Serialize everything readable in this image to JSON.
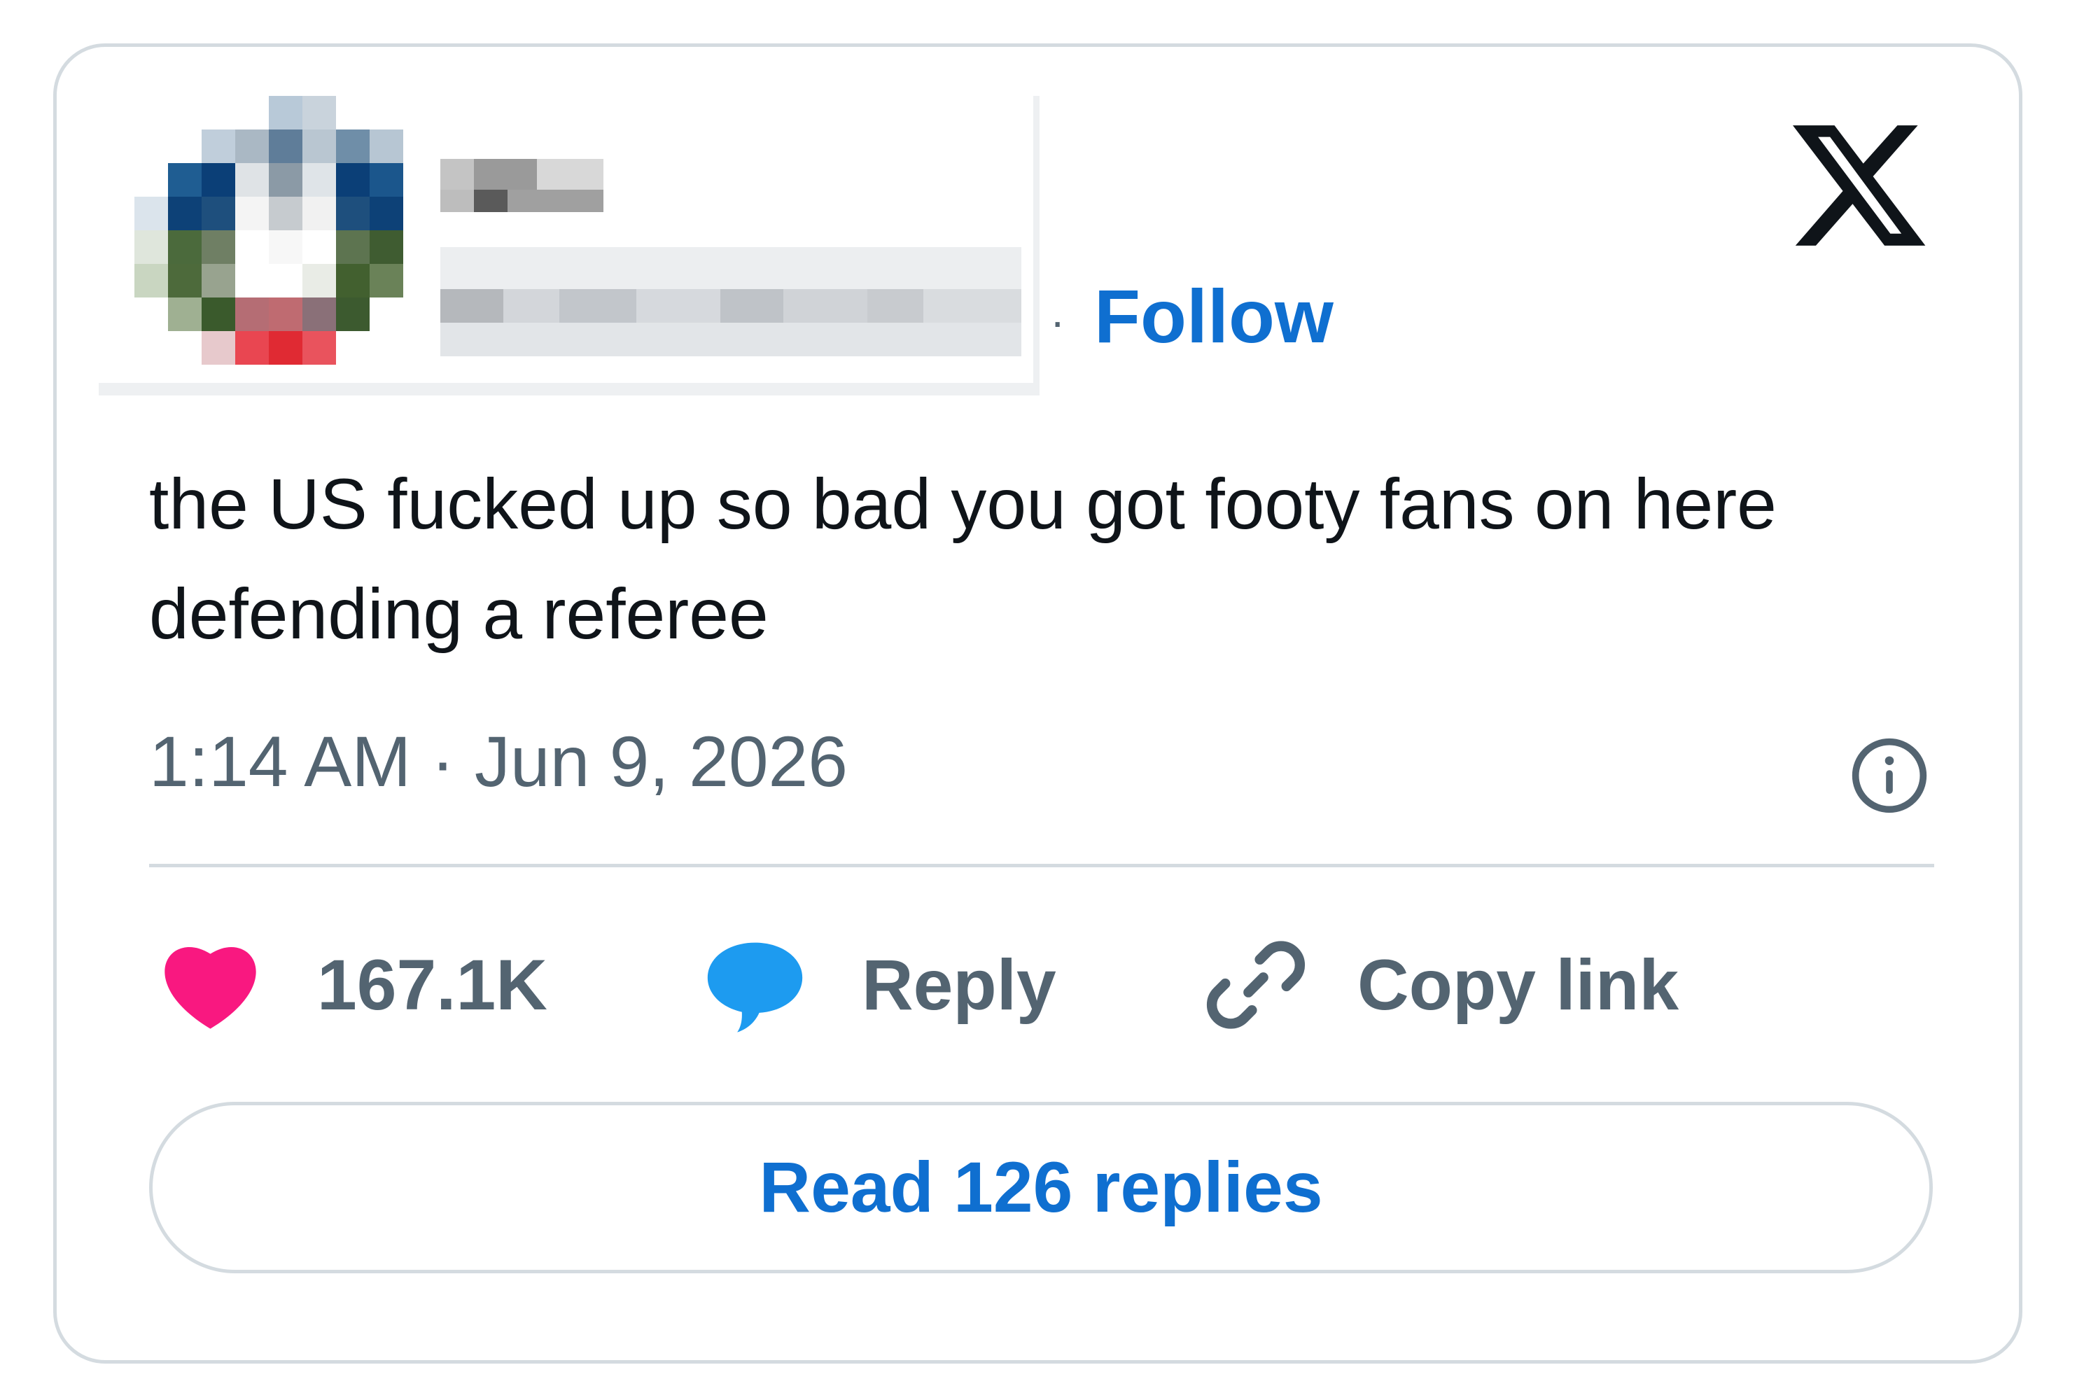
{
  "header": {
    "follow_label": "Follow",
    "separator": "·"
  },
  "tweet": {
    "text": "the US fucked up so bad you got footy fans on here defending a referee",
    "time": "1:14 AM",
    "separator": "·",
    "date": "Jun 9, 2026"
  },
  "actions": {
    "like_count": "167.1K",
    "reply_label": "Reply",
    "copy_label": "Copy link"
  },
  "read_replies_label": "Read 126 replies",
  "colors": {
    "accent": "#0f6fd0",
    "like": "#f91880",
    "reply": "#1d9bf0",
    "text": "#0f1419",
    "muted": "#536471",
    "border": "#d4dbe0"
  },
  "icons": {
    "brand": "x-logo-icon",
    "info": "info-icon",
    "like": "heart-icon",
    "reply": "speech-bubble-icon",
    "copy": "link-icon"
  }
}
